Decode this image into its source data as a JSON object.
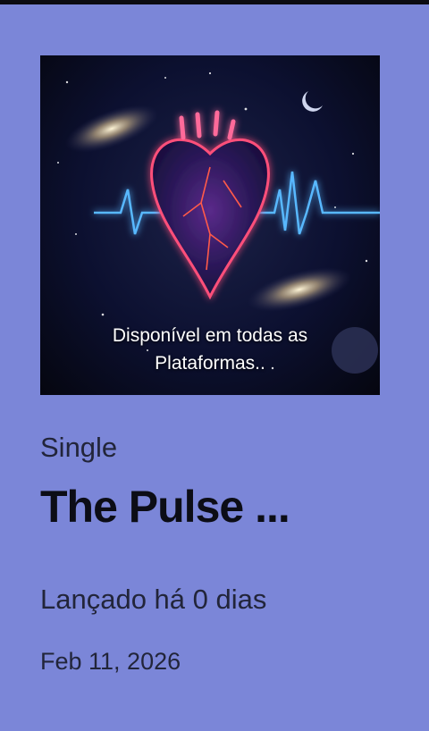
{
  "cover": {
    "caption_line1": "Disponível em todas as",
    "caption_line2": "Plataformas.."
  },
  "release": {
    "kind": "Single",
    "title": "The Pulse ...",
    "released_text": "Lançado há 0 dias",
    "date": "Feb 11, 2026"
  },
  "colors": {
    "background": "#7b86d8",
    "heart_glow": "#ff4f7a",
    "pulse_line": "#59b8ff"
  }
}
